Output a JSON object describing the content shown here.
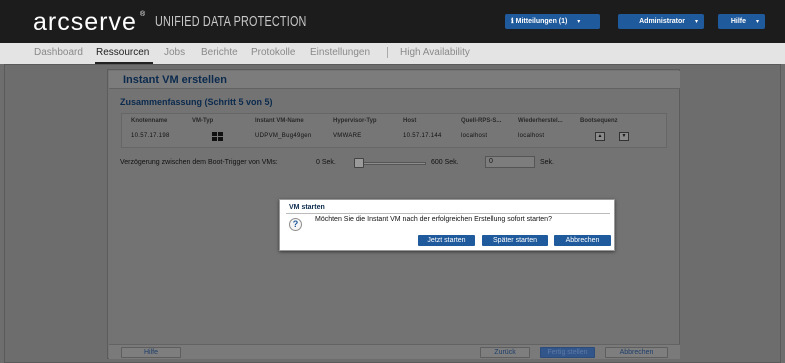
{
  "header": {
    "logo": "arcserve",
    "logo_mark": "®",
    "product": "UNIFIED DATA PROTECTION",
    "messages_label": "Mitteilungen (1)",
    "user_label": "Administrator",
    "help_label": "Hilfe",
    "caret": "▾",
    "info_icon": "ℹ"
  },
  "nav": {
    "items": [
      "Dashboard",
      "Ressourcen",
      "Jobs",
      "Berichte",
      "Protokolle",
      "Einstellungen",
      "High Availability"
    ],
    "active": "Ressourcen",
    "separator": "|"
  },
  "wizard": {
    "title": "Instant VM erstellen",
    "step_heading": "Zusammenfassung (Schritt 5 von 5)",
    "table": {
      "columns": [
        "Knotenname",
        "VM-Typ",
        "Instant VM-Name",
        "Hypervisor-Typ",
        "Host",
        "Quell-RPS-S...",
        "Wiederherstel...",
        "Bootsequenz"
      ],
      "row": {
        "node": "10.57.17.198",
        "vm_type_icon": "windows-icon",
        "vm_name": "UDPVM_Bug49gen",
        "hypervisor": "VMWARE",
        "host": "10.57.17.144",
        "source_rps": "localhost",
        "recovery": "localhost",
        "boot_up": "▲",
        "boot_down": "▼"
      }
    },
    "delay": {
      "label": "Verzögerung zwischen dem Boot-Trigger von VMs:",
      "min": "0 Sek.",
      "max": "600 Sek.",
      "value": "0",
      "unit": "Sek.",
      "level": 0
    },
    "footer": {
      "help": "Hilfe",
      "back": "Zurück",
      "create": "Fertig stellen",
      "cancel": "Abbrechen"
    }
  },
  "dialog": {
    "title": "VM starten",
    "icon": "?",
    "message": "Möchten Sie die Instant VM nach der erfolgreichen Erstellung sofort starten?",
    "btn_now": "Jetzt starten",
    "btn_later": "Später starten",
    "btn_cancel": "Abbrechen"
  }
}
